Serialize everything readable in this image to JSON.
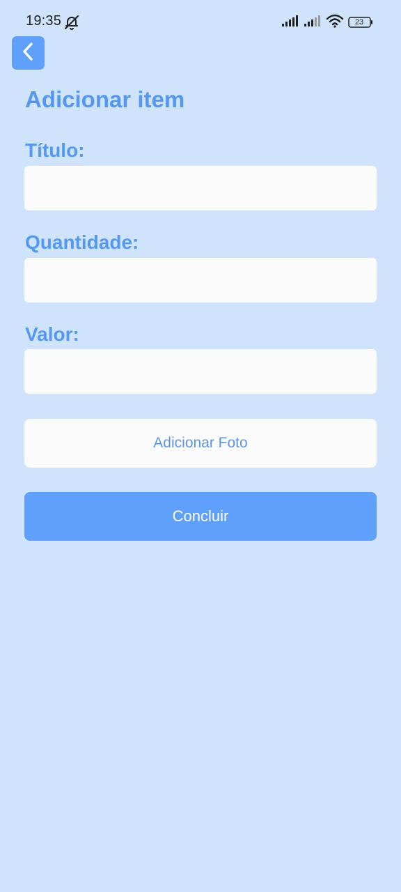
{
  "status_bar": {
    "time": "19:35",
    "battery_level": "23",
    "icons": [
      "bell-off-icon",
      "signal-icon",
      "signal-icon",
      "wifi-icon",
      "battery-icon"
    ]
  },
  "header": {
    "back_icon": "chevron-left-icon",
    "title": "Adicionar item"
  },
  "form": {
    "title_label": "Título:",
    "title_value": "",
    "quantity_label": "Quantidade:",
    "quantity_value": "",
    "value_label": "Valor:",
    "value_value": "",
    "add_photo_label": "Adicionar Foto",
    "submit_label": "Concluir"
  },
  "colors": {
    "background": "#cfe3fd",
    "accent": "#5fa0fc",
    "label": "#5598f0",
    "input_bg": "#fbfbfb"
  }
}
